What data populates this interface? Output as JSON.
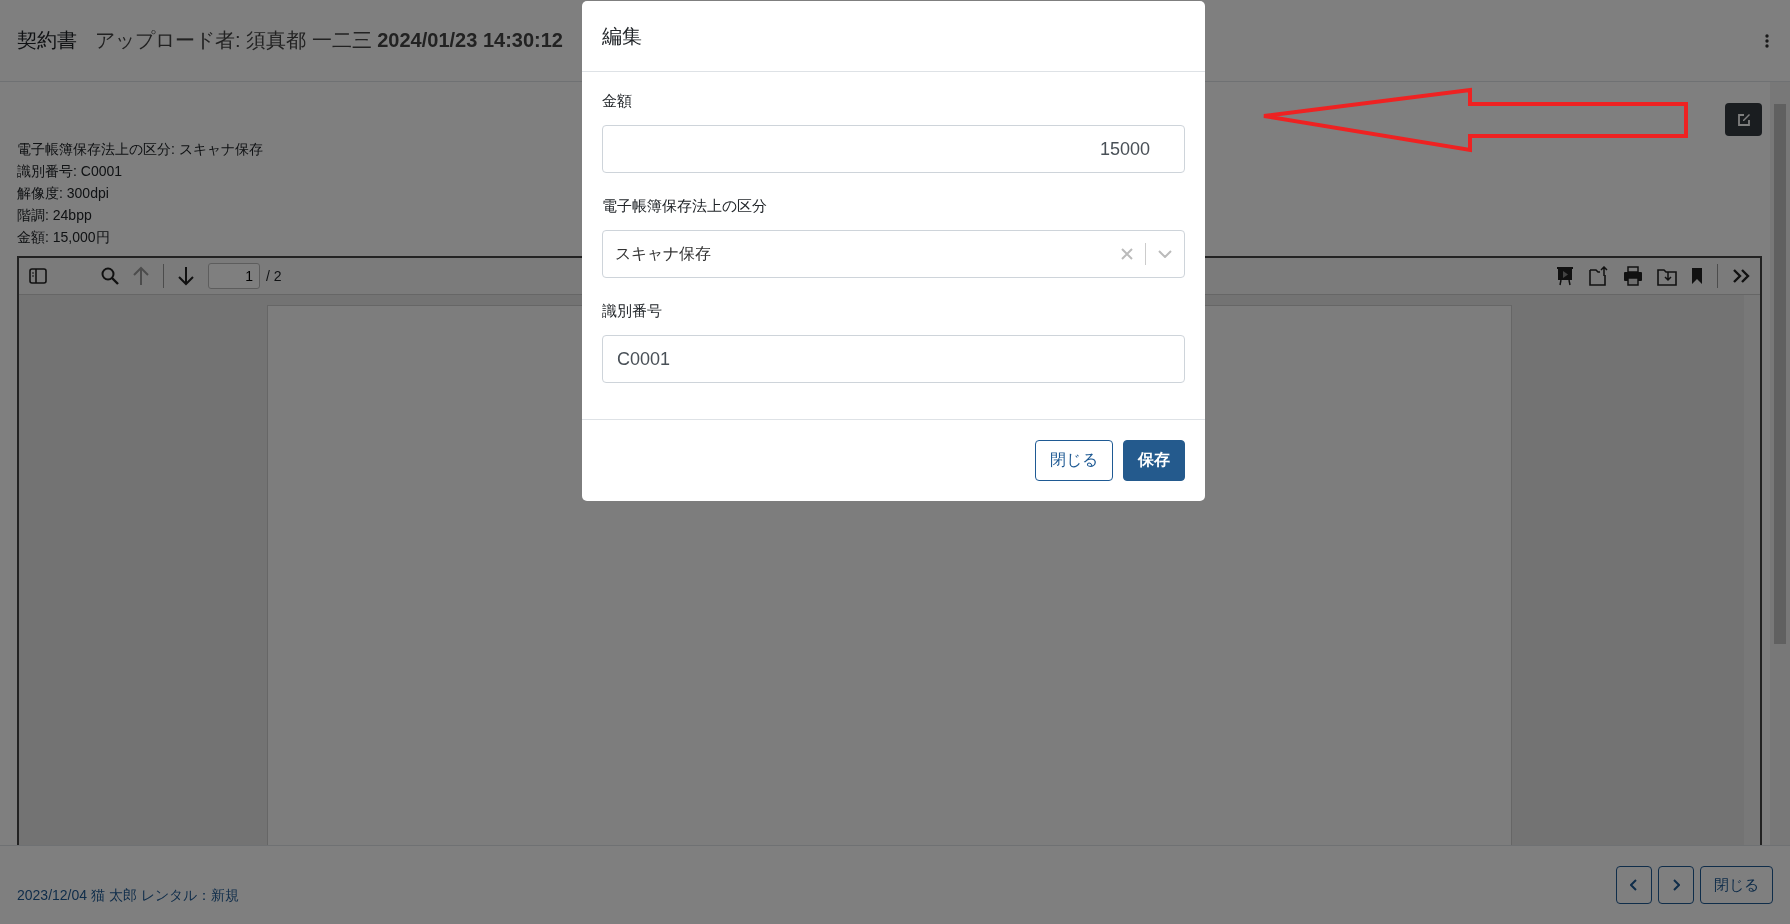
{
  "header": {
    "title": "契約書",
    "uploader": "アップロード者: 須真都 一二三 **2024/01/23 14:30:12**"
  },
  "info_lines": [
    "電子帳簿保存法上の区分: スキャナ保存",
    "識別番号: C0001",
    "解像度: 300dpi",
    "階調: 24bpp",
    "金額: 15,000円"
  ],
  "pdf_toolbar": {
    "page_nav": [
      {
        "kind": "up",
        "disabled": true
      },
      {
        "kind": "down",
        "disabled": false
      }
    ],
    "page": "1",
    "total": "/ 2"
  },
  "modal": {
    "title": "編集",
    "fields": [
      {
        "kind": "number",
        "label": "金額",
        "value": "15000"
      },
      {
        "kind": "select",
        "label": "電子帳簿保存法上の区分",
        "value": "スキャナ保存"
      },
      {
        "kind": "text",
        "label": "識別番号",
        "value": "C0001"
      }
    ],
    "buttons": [
      {
        "kind": "secondary",
        "label": "閉じる"
      },
      {
        "kind": "primary",
        "label": "保存"
      }
    ]
  },
  "footer": {
    "text": "2023/12/04 猫 太郎 レンタル：新規",
    "close": "閉じる"
  }
}
